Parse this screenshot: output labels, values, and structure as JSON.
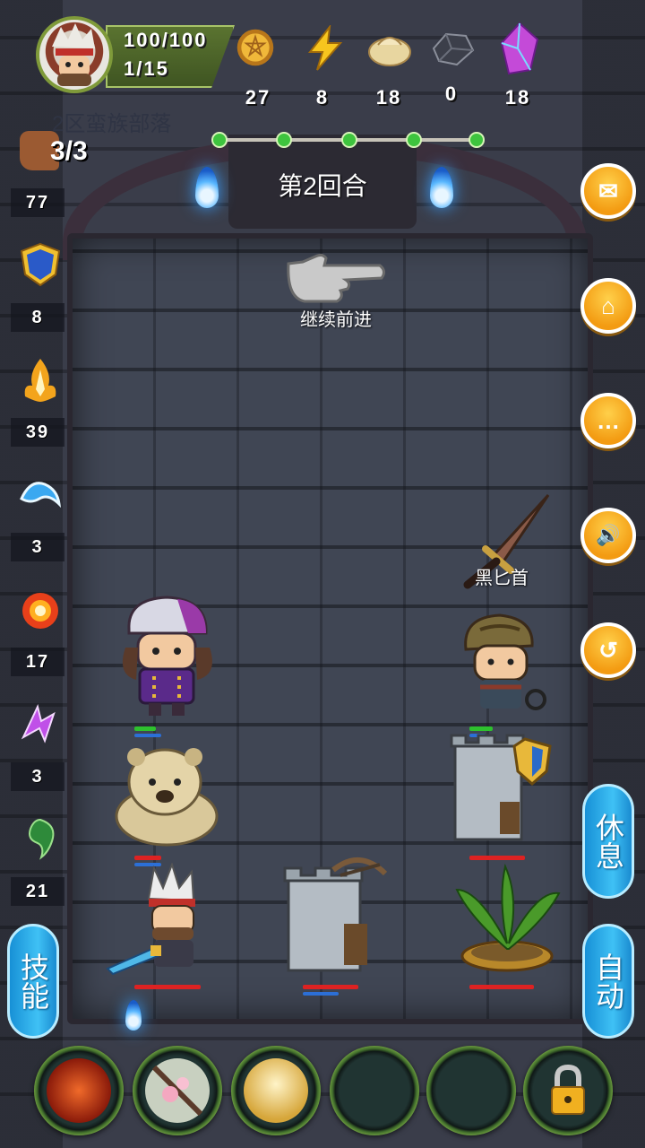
{
  "player": {
    "hp": "100/100",
    "level": "1/15",
    "avatar_icon": "ninja-hero-avatar"
  },
  "resources": [
    {
      "name": "coin-icon",
      "value": "27",
      "color": "#e2a626"
    },
    {
      "name": "energy-icon",
      "value": "8",
      "color": "#f7c51e"
    },
    {
      "name": "dumpling-icon",
      "value": "18",
      "color": "#e8d6a0"
    },
    {
      "name": "ore-icon",
      "value": "0",
      "color": "#3c3f4a"
    },
    {
      "name": "crystal-icon",
      "value": "18",
      "color": "#c44ad8"
    }
  ],
  "zone_title": "2区蛮族部落",
  "attack": {
    "charges": "3/3"
  },
  "stats": [
    {
      "icon": "fist-icon",
      "value": "77"
    },
    {
      "icon": "shield-icon",
      "value": "8"
    },
    {
      "icon": "fire-sword-icon",
      "value": "39"
    },
    {
      "icon": "water-wave-icon",
      "value": "3"
    },
    {
      "icon": "fireball-icon",
      "value": "17"
    },
    {
      "icon": "lightning-icon",
      "value": "3"
    },
    {
      "icon": "poison-icon",
      "value": "21"
    }
  ],
  "progress": {
    "nodes": 5,
    "completed": 5
  },
  "round_label": "第2回合",
  "continue_label": "继续前进",
  "loot": {
    "name": "黑匕首"
  },
  "side_buttons": [
    {
      "name": "mail-button",
      "glyph": "✉"
    },
    {
      "name": "home-button",
      "glyph": "⌂"
    },
    {
      "name": "chat-button",
      "glyph": "…"
    },
    {
      "name": "sound-button",
      "glyph": "🔊"
    },
    {
      "name": "back-button",
      "glyph": "↺"
    }
  ],
  "buttons": {
    "rest": "休息",
    "auto": "自动",
    "skill": "技能"
  },
  "skill_slots": [
    {
      "name": "skill-slot-phoenix",
      "state": "filled",
      "color": "#c23a1a"
    },
    {
      "name": "skill-slot-sakura-staff",
      "state": "filled",
      "color": "#5b3a2a"
    },
    {
      "name": "skill-slot-holy-wing",
      "state": "filled",
      "color": "#d6a63a"
    },
    {
      "name": "skill-slot-empty-1",
      "state": "empty"
    },
    {
      "name": "skill-slot-empty-2",
      "state": "empty"
    },
    {
      "name": "skill-slot-locked",
      "state": "locked"
    }
  ],
  "colors": {
    "accent_orange": "#f39b12",
    "accent_blue": "#2aa8e8",
    "hp_red": "#d22222",
    "hp_green": "#2ec12e"
  }
}
